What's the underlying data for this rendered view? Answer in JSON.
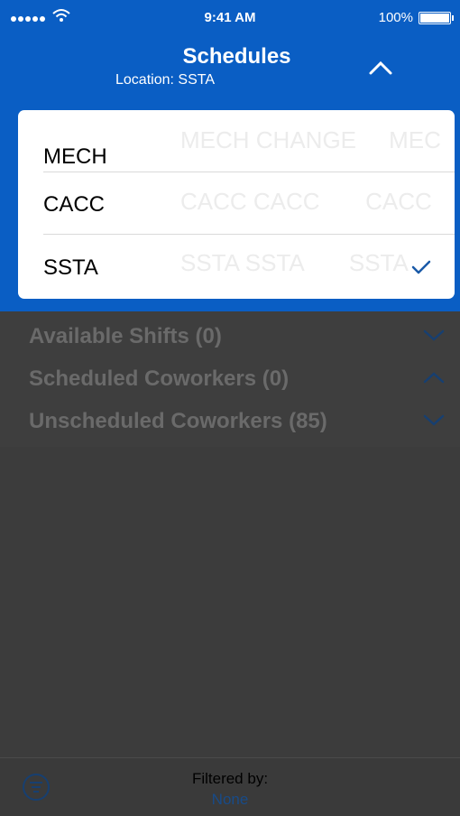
{
  "status_bar": {
    "time": "9:41 AM",
    "battery": "100%"
  },
  "header": {
    "title": "Schedules",
    "location_label": "Location:",
    "location_value": "SSTA"
  },
  "dropdown": {
    "options": [
      {
        "label": "MECH",
        "selected": false
      },
      {
        "label": "CACC",
        "selected": false
      },
      {
        "label": "SSTA",
        "selected": true
      }
    ]
  },
  "sections": [
    {
      "label": "Available Shifts (0)",
      "expanded": false
    },
    {
      "label": "Scheduled Coworkers (0)",
      "expanded": true
    },
    {
      "label": "Unscheduled Coworkers (85)",
      "expanded": false
    }
  ],
  "footer": {
    "filter_caption": "Filtered by:",
    "filter_value": "None"
  },
  "colors": {
    "header_blue": "#0a5ec4",
    "accent_blue": "#1a5aa8",
    "overlay": "#3e3e3e"
  }
}
